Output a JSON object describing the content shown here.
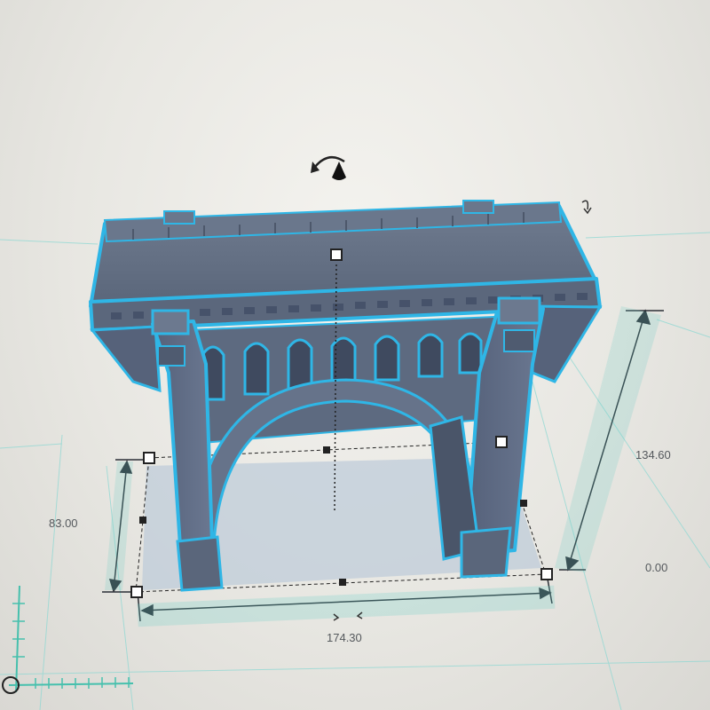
{
  "workplane": {
    "grid_color": "#5fc4c0",
    "background": "#e9e8e4"
  },
  "model": {
    "fill": "#5e6b7f",
    "outline": "#2fb6e6",
    "shadow": "#b9c9d6"
  },
  "dimensions": {
    "width": "174.30",
    "height": "134.60",
    "depth": "83.00",
    "elevation": "0.00"
  },
  "icons": {
    "rotate": "rotate-arrow-icon",
    "cone": "lift-cone-icon",
    "corner": "corner-rotate-icon"
  }
}
